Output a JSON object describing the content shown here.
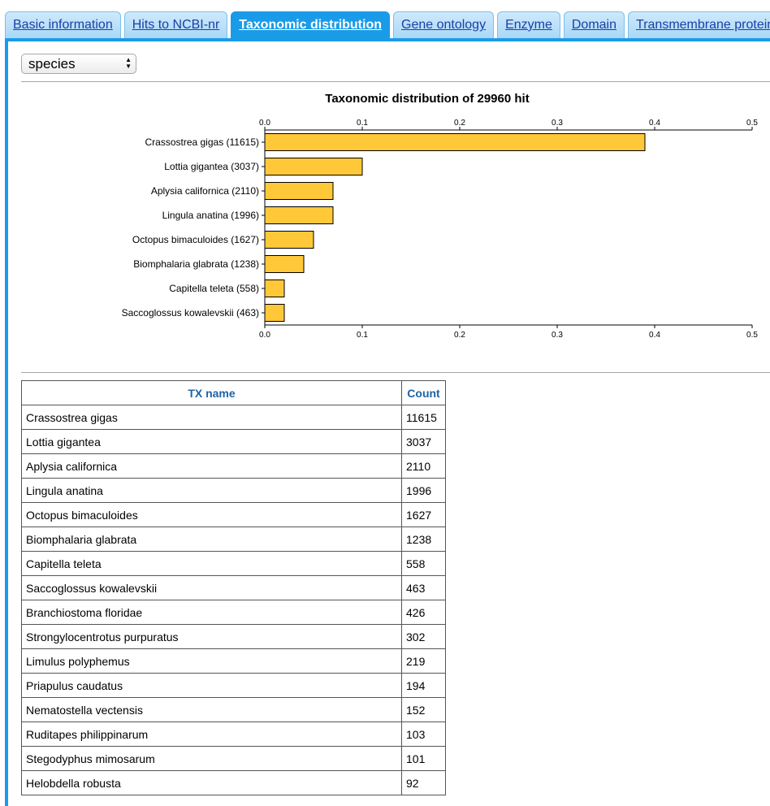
{
  "tabs": [
    {
      "label": "Basic information",
      "active": false
    },
    {
      "label": "Hits to NCBI-nr",
      "active": false
    },
    {
      "label": "Taxonomic distribution",
      "active": true
    },
    {
      "label": "Gene ontology",
      "active": false
    },
    {
      "label": "Enzyme",
      "active": false
    },
    {
      "label": "Domain",
      "active": false
    },
    {
      "label": "Transmembrane protein",
      "active": false
    }
  ],
  "rank_select": {
    "value": "species"
  },
  "colors": {
    "accent": "#1a9be8",
    "bar_fill": "#ffc839",
    "header_text": "#1f62a6"
  },
  "chart_data": {
    "type": "bar",
    "orientation": "horizontal",
    "title": "Taxonomic distribution of 29960 hit",
    "categories": [
      "Crassostrea gigas (11615)",
      "Lottia gigantea (3037)",
      "Aplysia californica (2110)",
      "Lingula anatina (1996)",
      "Octopus bimaculoides (1627)",
      "Biomphalaria glabrata (1238)",
      "Capitella teleta (558)",
      "Saccoglossus kowalevskii (463)"
    ],
    "values": [
      0.39,
      0.1,
      0.07,
      0.07,
      0.05,
      0.04,
      0.02,
      0.02
    ],
    "xlim": [
      0,
      0.5
    ],
    "ticks": [
      "0.0",
      "0.1",
      "0.2",
      "0.3",
      "0.4",
      "0.5"
    ],
    "grid": false
  },
  "table": {
    "headers": {
      "name": "TX name",
      "count": "Count"
    },
    "rows": [
      {
        "name": "Crassostrea gigas",
        "count": "11615"
      },
      {
        "name": "Lottia gigantea",
        "count": "3037"
      },
      {
        "name": "Aplysia californica",
        "count": "2110"
      },
      {
        "name": "Lingula anatina",
        "count": "1996"
      },
      {
        "name": "Octopus bimaculoides",
        "count": "1627"
      },
      {
        "name": "Biomphalaria glabrata",
        "count": "1238"
      },
      {
        "name": "Capitella teleta",
        "count": "558"
      },
      {
        "name": "Saccoglossus kowalevskii",
        "count": "463"
      },
      {
        "name": "Branchiostoma floridae",
        "count": "426"
      },
      {
        "name": "Strongylocentrotus purpuratus",
        "count": "302"
      },
      {
        "name": "Limulus polyphemus",
        "count": "219"
      },
      {
        "name": "Priapulus caudatus",
        "count": "194"
      },
      {
        "name": "Nematostella vectensis",
        "count": "152"
      },
      {
        "name": "Ruditapes philippinarum",
        "count": "103"
      },
      {
        "name": "Stegodyphus mimosarum",
        "count": "101"
      },
      {
        "name": "Helobdella robusta",
        "count": "92"
      }
    ]
  }
}
